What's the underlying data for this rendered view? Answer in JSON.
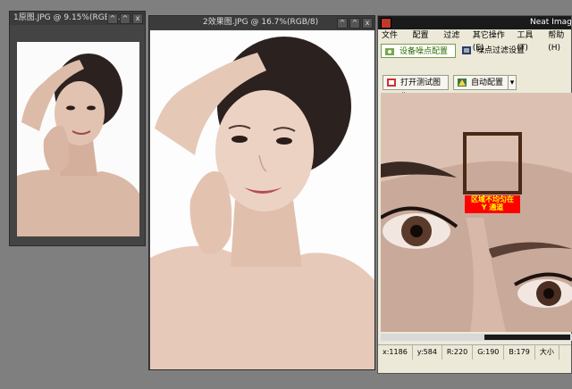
{
  "windows": {
    "original": {
      "title": "1原图.JPG @ 9.15%(RGB/...",
      "controls": [
        "^",
        "^",
        "x"
      ]
    },
    "result": {
      "title": "2效果图.JPG @ 16.7%(RGB/8)",
      "controls": [
        "^",
        "^",
        "x"
      ]
    }
  },
  "neat_image": {
    "title": "Neat Image",
    "menu": [
      "文件(F)",
      "配置(P)",
      "过滤(I)",
      "其它操作(E)",
      "工具(T)",
      "帮助(H)"
    ],
    "tabs": [
      {
        "label": "设备噪点配置",
        "active": true
      },
      {
        "label": "噪点过滤设置",
        "active": false
      }
    ],
    "toolbar": {
      "open_label": "打开测试图像",
      "auto_label": "自动配置",
      "dropdown_glyph": "▾"
    },
    "selection_warning": "区域不均匀在\nY 通道",
    "status": {
      "x": "x:1186",
      "y": "y:584",
      "r": "R:220",
      "g": "G:190",
      "b": "B:179",
      "extra": "大小"
    }
  },
  "colors": {
    "workspace": "#7f7f7f",
    "skin": "#e3c4b4",
    "hair": "#2b2220",
    "warning_bg": "#ff0000",
    "warning_text": "#ffff00",
    "selection": "#4a2a16"
  }
}
